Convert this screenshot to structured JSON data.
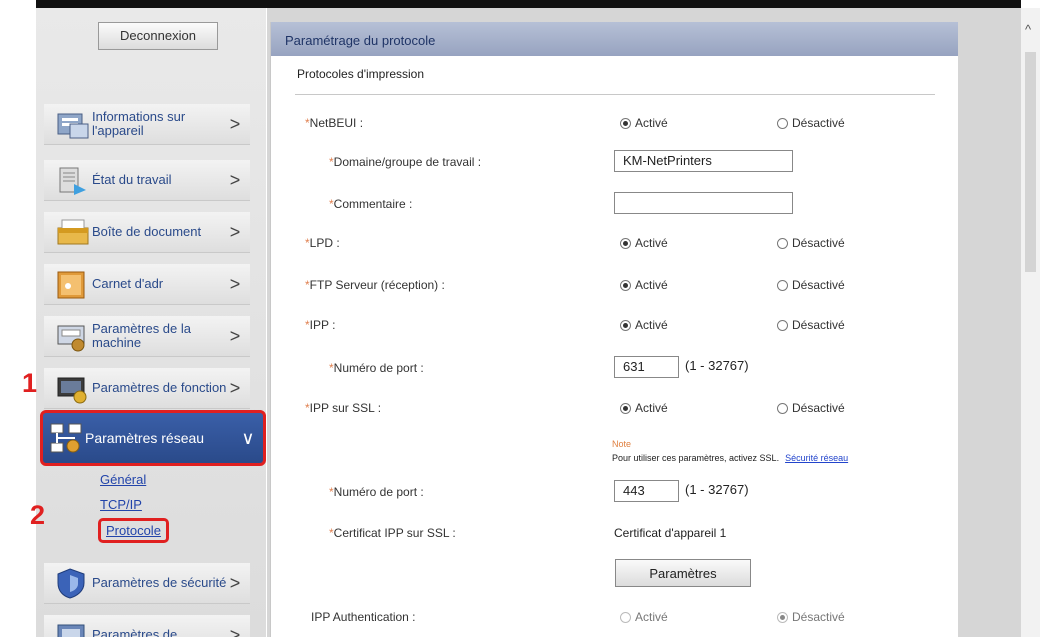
{
  "sidebar": {
    "logout_label": "Deconnexion",
    "items": [
      {
        "label": "Informations sur l'appareil",
        "icon": "device-info-icon",
        "chev": ">"
      },
      {
        "label": "État du travail",
        "icon": "job-status-icon",
        "chev": ">"
      },
      {
        "label": "Boîte de document",
        "icon": "document-box-icon",
        "chev": ">"
      },
      {
        "label": "Carnet d'adr",
        "icon": "address-book-icon",
        "chev": ">"
      },
      {
        "label": "Paramètres de la machine",
        "icon": "machine-settings-icon",
        "chev": ">"
      },
      {
        "label": "Paramètres de fonction",
        "icon": "function-settings-icon",
        "chev": ">"
      },
      {
        "label": "Paramètres réseau",
        "icon": "network-settings-icon",
        "chev": "∨"
      },
      {
        "label": "Paramètres de sécurité",
        "icon": "security-settings-icon",
        "chev": ">"
      },
      {
        "label": "Paramètres de",
        "icon": "management-settings-icon",
        "chev": ">"
      }
    ],
    "sub_items": [
      {
        "label": "Général"
      },
      {
        "label": "TCP/IP"
      },
      {
        "label": "Protocole"
      }
    ]
  },
  "annotations": {
    "step1": "1",
    "step2": "2"
  },
  "panel": {
    "title": "Paramétrage du protocole",
    "section_title": "Protocoles d'impression",
    "star": "*",
    "radio_on": "Activé",
    "radio_off": "Désactivé",
    "rows": {
      "netbeui": "NetBEUI :",
      "workgroup": "Domaine/groupe de travail :",
      "comment": "Commentaire :",
      "lpd": "LPD :",
      "ftp": "FTP Serveur (réception) :",
      "ipp": "IPP :",
      "ipp_port": "Numéro de port :",
      "ipp_ssl": "IPP sur SSL :",
      "ssl_port": "Numéro de port :",
      "ssl_cert": "Certificat IPP sur SSL :",
      "ipp_auth": "IPP Authentication :"
    },
    "workgroup_value": "KM-NetPrinters",
    "comment_value": "",
    "ipp_port_value": "631",
    "ssl_port_value": "443",
    "port_range": "(1 - 32767)",
    "note_label": "Note",
    "note_text": "Pour utiliser ces paramètres, activez SSL.",
    "note_link": "Sécurité réseau",
    "cert_value": "Certificat d'appareil 1",
    "params_button": "Paramètres"
  },
  "colors": {
    "accent": "#e02020",
    "header": "#a6b1cb",
    "link": "#2244cc"
  }
}
